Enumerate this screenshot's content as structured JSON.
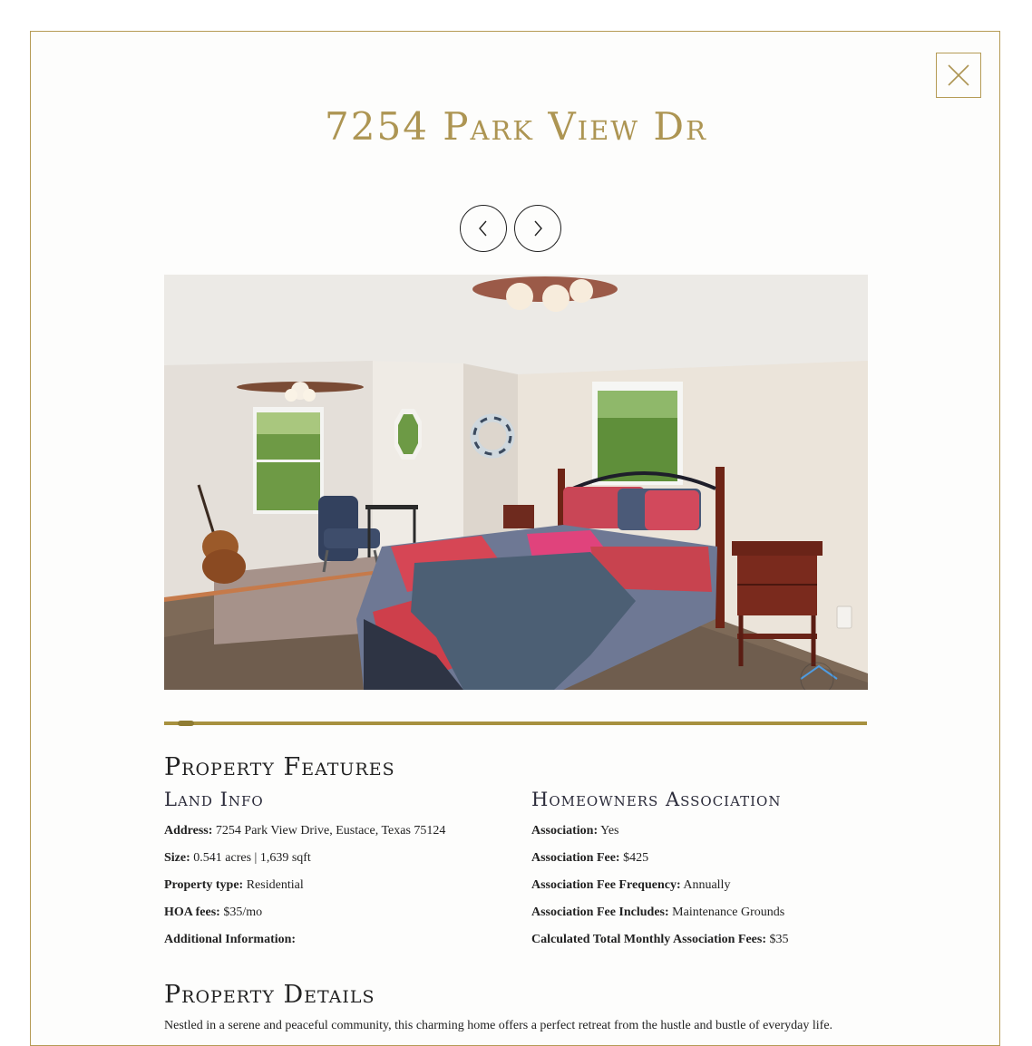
{
  "title": "7254 Park View Dr",
  "photo": {
    "alt": "Bedroom with patchwork quilt bed, ceiling fans, guitar and armchair"
  },
  "slider": {
    "progress": 0.02
  },
  "features": {
    "heading": "Property Features",
    "land": {
      "heading": "Land Info",
      "rows": [
        {
          "label": "Address:",
          "value": "7254 Park View Drive, Eustace, Texas 75124"
        },
        {
          "label": "Size:",
          "value": "0.541 acres | 1,639 sqft"
        },
        {
          "label": "Property type:",
          "value": "Residential"
        },
        {
          "label": "HOA fees:",
          "value": "$35/mo"
        },
        {
          "label": "Additional Information:",
          "value": ""
        }
      ]
    },
    "hoa": {
      "heading": "Homeowners Association",
      "rows": [
        {
          "label": "Association:",
          "value": "Yes"
        },
        {
          "label": "Association Fee:",
          "value": "$425"
        },
        {
          "label": "Association Fee Frequency:",
          "value": "Annually"
        },
        {
          "label": "Association Fee Includes:",
          "value": "Maintenance Grounds"
        },
        {
          "label": "Calculated Total Monthly Association Fees:",
          "value": "$35"
        }
      ]
    }
  },
  "details": {
    "heading": "Property Details",
    "text": "Nestled in a serene and peaceful community, this charming home offers a perfect retreat from the hustle and bustle of everyday life."
  },
  "colors": {
    "accent": "#ad9553",
    "border": "#b59b55",
    "progress": "#a7913f"
  },
  "icons": {
    "close": "close-icon",
    "prev": "chevron-left-icon",
    "next": "chevron-right-icon"
  }
}
